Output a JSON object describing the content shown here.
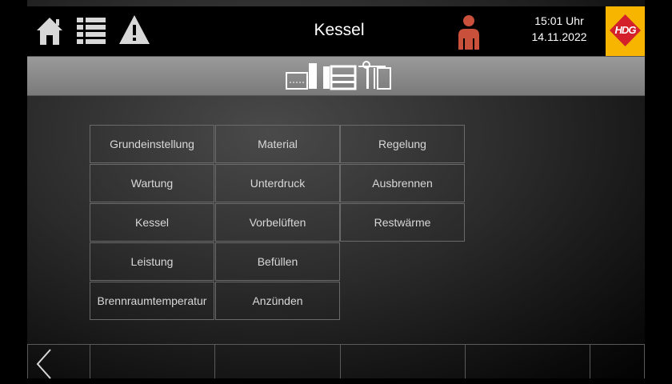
{
  "header": {
    "title": "Kessel",
    "time": "15:01 Uhr",
    "date": "14.11.2022",
    "logo_text": "HDG",
    "icons": [
      "home-icon",
      "list-icon",
      "warning-icon",
      "user-icon"
    ]
  },
  "subbar": {
    "icons": [
      "boiler-icon"
    ]
  },
  "menu": {
    "col1": [
      "Grundeinstellung",
      "Wartung",
      "Kessel",
      "Leistung",
      "Brennraumtemperatur"
    ],
    "col2": [
      "Material",
      "Unterdruck",
      "Vorbelüften",
      "Befüllen",
      "Anzünden"
    ],
    "col3": [
      "Regelung",
      "Ausbrennen",
      "Restwärme"
    ]
  },
  "nav": {
    "icons": [
      "chevron-left-icon"
    ]
  },
  "colors": {
    "logo": "#f7b500",
    "user": "#c9503a",
    "icon": "#d8d8d8"
  }
}
